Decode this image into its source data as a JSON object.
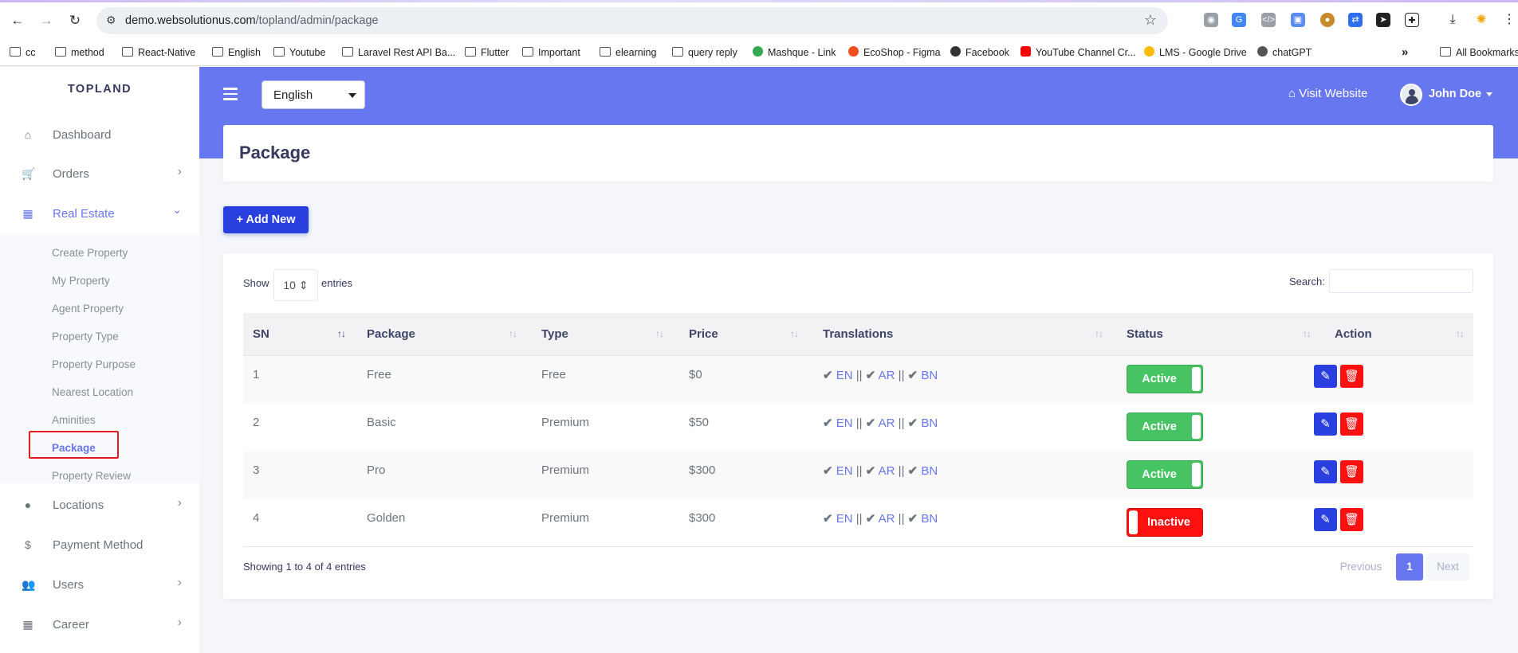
{
  "browser": {
    "nav": {
      "back": "←",
      "forward": "→",
      "reload": "↻"
    },
    "url_host": "demo.websolutionus.com",
    "url_path": "/topland/admin/package",
    "bookmarks": [
      "cc",
      "method",
      "React-Native",
      "English",
      "Youtube",
      "Laravel Rest API Ba...",
      "Flutter",
      "Important",
      "elearning",
      "query reply",
      "Mashque - Link",
      "EcoShop - Figma",
      "Facebook",
      "YouTube Channel Cr...",
      "LMS - Google Drive",
      "chatGPT"
    ],
    "more_label": "»",
    "all_bookmarks": "All Bookmarks"
  },
  "sidebar": {
    "brand": "TOPLAND",
    "items": [
      {
        "label": "Dashboard",
        "icon": "home-icon",
        "glyph": "⌂"
      },
      {
        "label": "Orders",
        "icon": "cart-icon",
        "glyph": "🛒"
      },
      {
        "label": "Real Estate",
        "icon": "building-icon",
        "glyph": "▦"
      },
      {
        "label": "Locations",
        "icon": "map-marker-icon",
        "glyph": "●"
      },
      {
        "label": "Payment Method",
        "icon": "dollar-icon",
        "glyph": "$"
      },
      {
        "label": "Users",
        "icon": "users-icon",
        "glyph": "👥"
      },
      {
        "label": "Career",
        "icon": "grid-icon",
        "glyph": "▦"
      }
    ],
    "real_estate_sub": [
      "Create Property",
      "My Property",
      "Agent Property",
      "Property Type",
      "Property Purpose",
      "Nearest Location",
      "Aminities",
      "Package",
      "Property Review"
    ]
  },
  "topbar": {
    "language": "English",
    "visit_label": "Visit Website",
    "user_name": "John Doe"
  },
  "page": {
    "title": "Package",
    "add_new_label": "Add New"
  },
  "table": {
    "show_label": "Show",
    "page_length": "10",
    "entries_label": "entries",
    "search_label": "Search:",
    "search_value": "",
    "headers": [
      "SN",
      "Package",
      "Type",
      "Price",
      "Translations",
      "Status",
      "Action"
    ],
    "rows": [
      {
        "sn": "1",
        "package": "Free",
        "type": "Free",
        "price": "$0",
        "status": "Active"
      },
      {
        "sn": "2",
        "package": "Basic",
        "type": "Premium",
        "price": "$50",
        "status": "Active"
      },
      {
        "sn": "3",
        "package": "Pro",
        "type": "Premium",
        "price": "$300",
        "status": "Active"
      },
      {
        "sn": "4",
        "package": "Golden",
        "type": "Premium",
        "price": "$300",
        "status": "Inactive"
      }
    ],
    "translations": [
      "EN",
      "AR",
      "BN"
    ],
    "translation_separator": "||",
    "info": "Showing 1 to 4 of 4 entries",
    "pagination": {
      "previous": "Previous",
      "current": "1",
      "next": "Next"
    }
  },
  "colors": {
    "primary": "#6777ef",
    "active": "#47c363",
    "inactive": "#fc1010",
    "edit": "#2a3fe0"
  }
}
